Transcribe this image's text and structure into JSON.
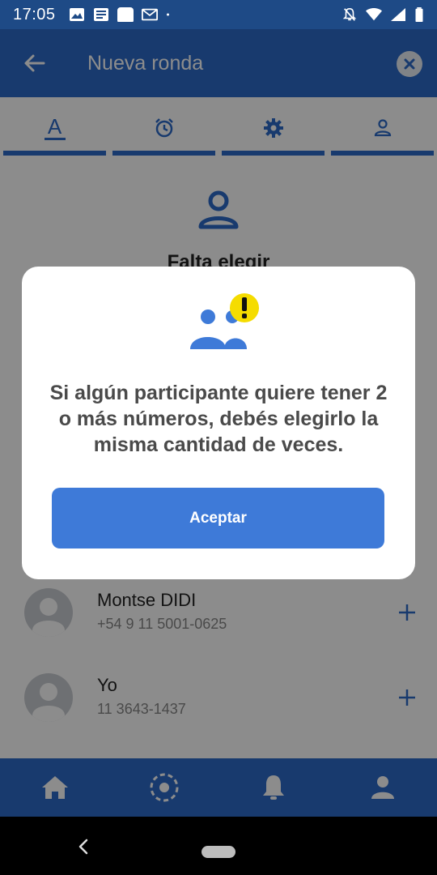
{
  "status_bar": {
    "time": "17:05"
  },
  "app_bar": {
    "title": "Nueva ronda"
  },
  "tabs": [
    {
      "icon": "font-letter-icon",
      "label": "A",
      "active": true
    },
    {
      "icon": "alarm-clock-icon",
      "active": false
    },
    {
      "icon": "gear-icon",
      "active": false
    },
    {
      "icon": "person-icon",
      "active": false
    }
  ],
  "content": {
    "status_text": "Falta elegir",
    "contacts": [
      {
        "name": "Montse DIDI",
        "phone": "+54 9 11 5001-0625"
      },
      {
        "name": "Yo",
        "phone": "11 3643-1437"
      }
    ]
  },
  "dialog": {
    "message": "Si algún participante quiere tener 2 o más números, debés elegirlo la misma cantidad de veces.",
    "accept_label": "Aceptar"
  },
  "bottom_nav": [
    {
      "icon": "home-icon"
    },
    {
      "icon": "roulette-icon"
    },
    {
      "icon": "bell-icon"
    },
    {
      "icon": "profile-icon"
    }
  ],
  "colors": {
    "primary": "#2c6ac8",
    "button": "#3e7ad8",
    "warning_yellow": "#f5dc00"
  }
}
